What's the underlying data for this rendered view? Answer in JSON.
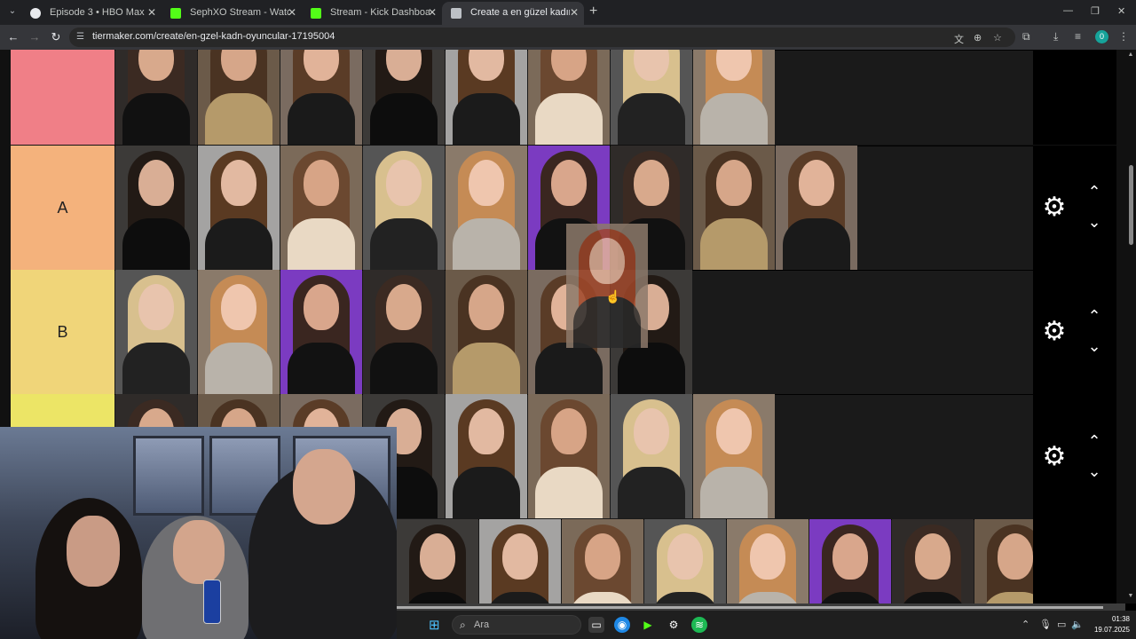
{
  "browser": {
    "tabs": [
      {
        "title": "Episode 3 • HBO Max",
        "favicon_color": "#e8eaed",
        "active": false
      },
      {
        "title": "SephXO Stream - Watch Live on",
        "favicon_color": "#53fc18",
        "active": false
      },
      {
        "title": "Stream - Kick Dashboard",
        "favicon_color": "#53fc18",
        "active": false
      },
      {
        "title": "Create a en güzel kadın oyuncu",
        "favicon_color": "#bdc1c6",
        "active": true
      }
    ],
    "new_tab": "+",
    "window": {
      "minimize": "—",
      "restore": "❐",
      "close": "✕"
    },
    "url": "tiermaker.com/create/en-gzel-kadn-oyuncular-17195004",
    "profile_initial": "0"
  },
  "tiers": [
    {
      "label": "",
      "color": "#f07f87",
      "tiles": 8
    },
    {
      "label": "A",
      "color": "#f4b27c",
      "tiles": 9
    },
    {
      "label": "B",
      "color": "#f0d579",
      "tiles": 7
    },
    {
      "label": "",
      "color": "#ece566",
      "tiles": 8
    },
    {
      "label": "",
      "color": "#d8ea70",
      "tiles": 8
    }
  ],
  "tile_palettes": [
    {
      "bg": "#2f2b29",
      "hair": "#3b2a22",
      "skin": "#d8a98c",
      "body": "#111111"
    },
    {
      "bg": "#6b5a49",
      "hair": "#4a3322",
      "skin": "#d6a689",
      "body": "#b59a6a"
    },
    {
      "bg": "#7a6b60",
      "hair": "#5a3c27",
      "skin": "#e1b399",
      "body": "#1a1a1a"
    },
    {
      "bg": "#3c3a38",
      "hair": "#221a15",
      "skin": "#d9ae95",
      "body": "#0d0d0d"
    },
    {
      "bg": "#a4a3a2",
      "hair": "#5a3a22",
      "skin": "#e2b9a1",
      "body": "#1b1b1b"
    },
    {
      "bg": "#7b6a59",
      "hair": "#6b4830",
      "skin": "#d7a486",
      "body": "#e9d9c4"
    },
    {
      "bg": "#555555",
      "hair": "#d8c08e",
      "skin": "#e8c4ad",
      "body": "#222222"
    },
    {
      "bg": "#8a7a6a",
      "hair": "#c58b55",
      "skin": "#efc6ae",
      "body": "#b9b3aa"
    },
    {
      "bg": "#7b3bc1",
      "hair": "#3a2620",
      "skin": "#d9a68c",
      "body": "#121212"
    }
  ],
  "controls": {
    "gear": "⚙",
    "up": "⌃",
    "down": "⌄"
  },
  "taskbar": {
    "search_placeholder": "Ara",
    "time": "01:38",
    "date": "19.07.2025"
  },
  "video_progress": 0.97
}
